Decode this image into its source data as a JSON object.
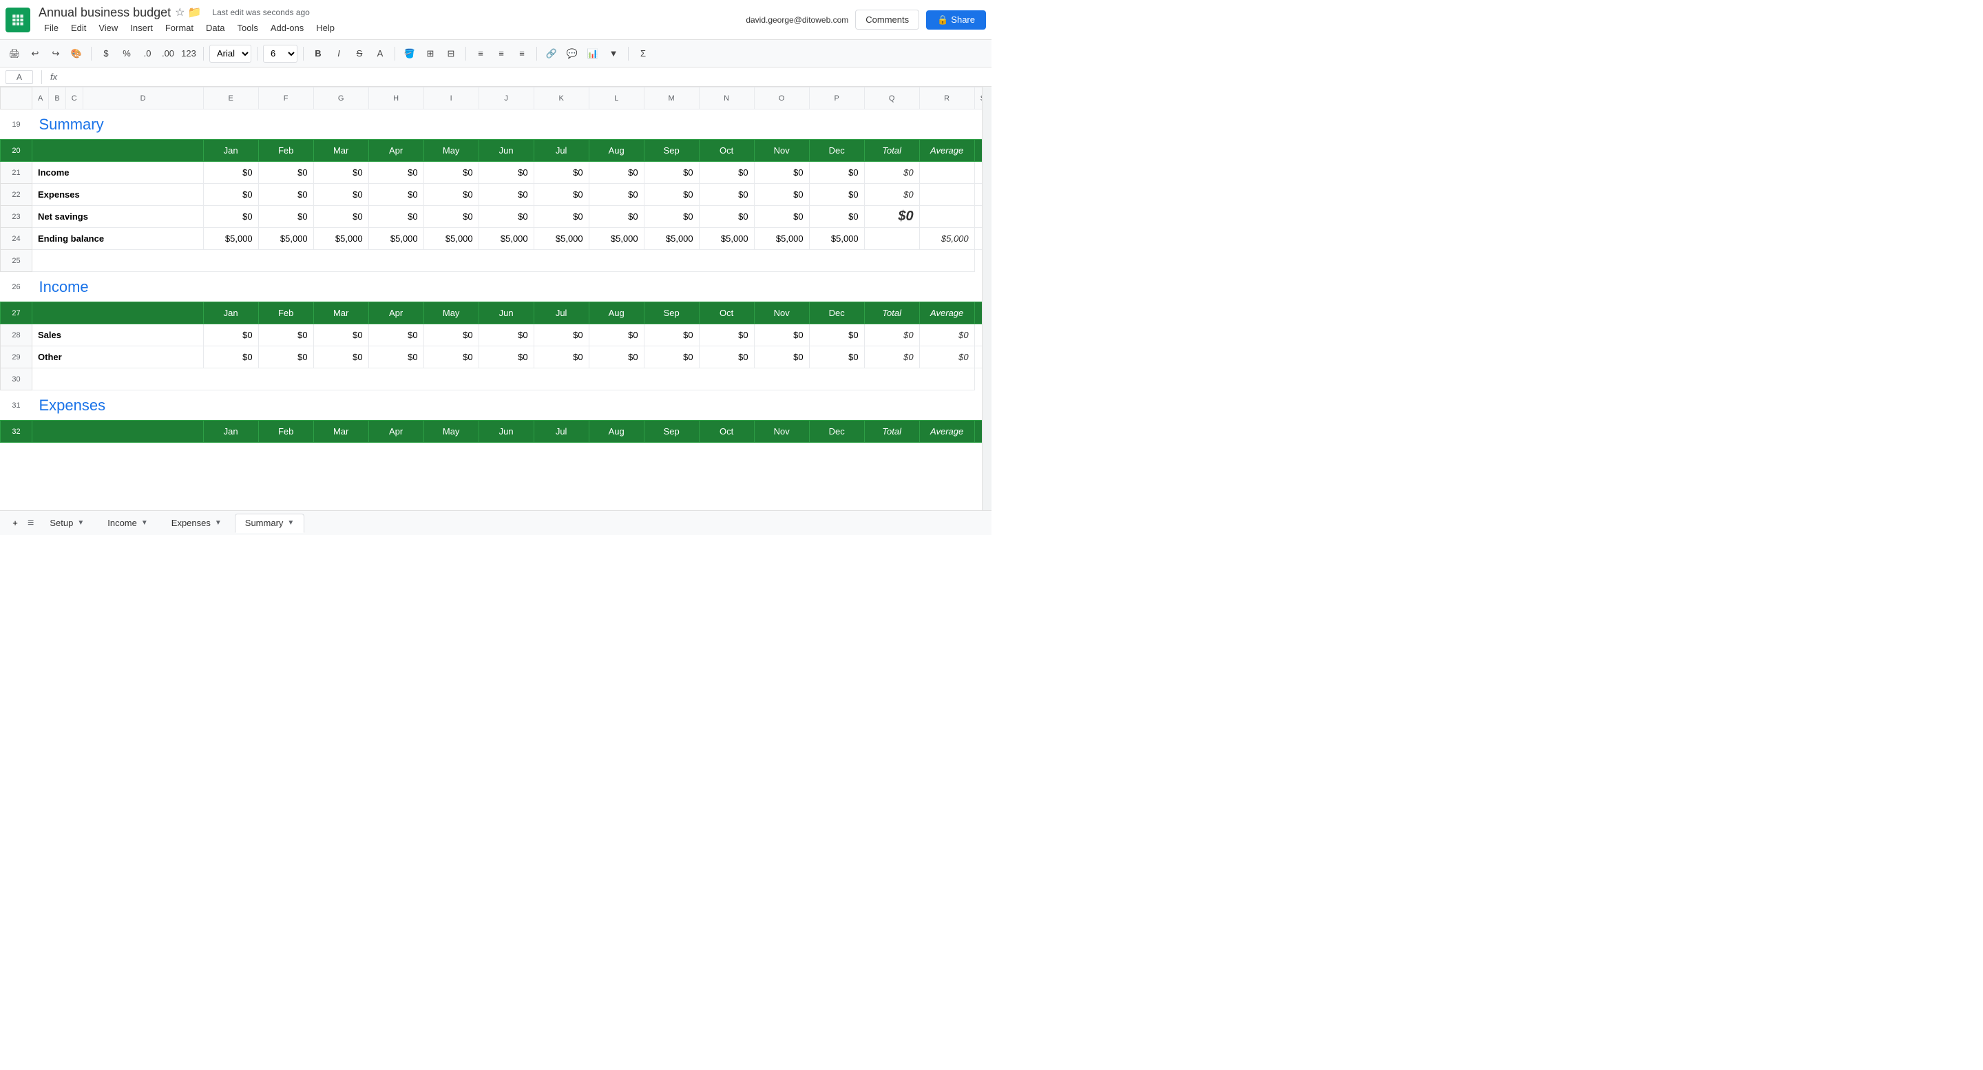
{
  "app": {
    "logo_color": "#0f9d58",
    "doc_title": "Annual business budget",
    "last_edit": "Last edit was seconds ago",
    "user_email": "david.george@ditoweb.com",
    "comments_label": "Comments",
    "share_label": "Share"
  },
  "menu": {
    "items": [
      "File",
      "Edit",
      "View",
      "Insert",
      "Format",
      "Data",
      "Tools",
      "Add-ons",
      "Help"
    ]
  },
  "toolbar": {
    "font": "Arial",
    "font_size": "6"
  },
  "formula_bar": {
    "label": "fx",
    "cell_ref": "A",
    "value": ""
  },
  "tabs": [
    {
      "label": "Setup",
      "active": false
    },
    {
      "label": "Income",
      "active": false
    },
    {
      "label": "Expenses",
      "active": false
    },
    {
      "label": "Summary",
      "active": true
    }
  ],
  "sections": {
    "summary": {
      "title": "Summary",
      "headers": [
        "",
        "Jan",
        "Feb",
        "Mar",
        "Apr",
        "May",
        "Jun",
        "Jul",
        "Aug",
        "Sep",
        "Oct",
        "Nov",
        "Dec",
        "Total",
        "Average"
      ],
      "rows": [
        {
          "label": "Income",
          "values": [
            "$0",
            "$0",
            "$0",
            "$0",
            "$0",
            "$0",
            "$0",
            "$0",
            "$0",
            "$0",
            "$0",
            "$0"
          ],
          "total": "$0",
          "avg": ""
        },
        {
          "label": "Expenses",
          "values": [
            "$0",
            "$0",
            "$0",
            "$0",
            "$0",
            "$0",
            "$0",
            "$0",
            "$0",
            "$0",
            "$0",
            "$0"
          ],
          "total": "$0",
          "avg": ""
        },
        {
          "label": "Net savings",
          "values": [
            "$0",
            "$0",
            "$0",
            "$0",
            "$0",
            "$0",
            "$0",
            "$0",
            "$0",
            "$0",
            "$0",
            "$0"
          ],
          "total": "$0",
          "avg": "",
          "big_total": true
        },
        {
          "label": "Ending balance",
          "values": [
            "$5,000",
            "$5,000",
            "$5,000",
            "$5,000",
            "$5,000",
            "$5,000",
            "$5,000",
            "$5,000",
            "$5,000",
            "$5,000",
            "$5,000",
            "$5,000"
          ],
          "total": "",
          "avg": "$5,000"
        }
      ],
      "row_numbers": [
        "19",
        "20",
        "21",
        "22",
        "23",
        "24",
        "25"
      ]
    },
    "income": {
      "title": "Income",
      "headers": [
        "",
        "Jan",
        "Feb",
        "Mar",
        "Apr",
        "May",
        "Jun",
        "Jul",
        "Aug",
        "Sep",
        "Oct",
        "Nov",
        "Dec",
        "Total",
        "Average"
      ],
      "rows": [
        {
          "label": "Sales",
          "values": [
            "$0",
            "$0",
            "$0",
            "$0",
            "$0",
            "$0",
            "$0",
            "$0",
            "$0",
            "$0",
            "$0",
            "$0"
          ],
          "total": "$0",
          "avg": "$0"
        },
        {
          "label": "Other",
          "values": [
            "$0",
            "$0",
            "$0",
            "$0",
            "$0",
            "$0",
            "$0",
            "$0",
            "$0",
            "$0",
            "$0",
            "$0"
          ],
          "total": "$0",
          "avg": "$0"
        }
      ],
      "row_numbers": [
        "26",
        "27",
        "28",
        "29",
        "30"
      ]
    },
    "expenses": {
      "title": "Expenses",
      "row_numbers": [
        "31",
        "32"
      ]
    }
  }
}
